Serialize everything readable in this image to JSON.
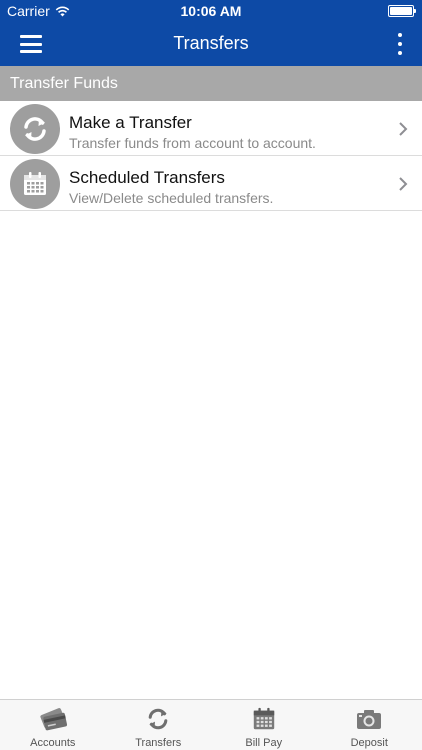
{
  "status": {
    "carrier": "Carrier",
    "time": "10:06 AM"
  },
  "nav": {
    "title": "Transfers"
  },
  "section": {
    "title": "Transfer Funds"
  },
  "items": [
    {
      "title": "Make a Transfer",
      "subtitle": "Transfer funds from account to account.",
      "icon": "transfer-arrows-icon"
    },
    {
      "title": "Scheduled Transfers",
      "subtitle": "View/Delete scheduled transfers.",
      "icon": "calendar-icon"
    }
  ],
  "tabs": [
    {
      "label": "Accounts",
      "icon": "accounts-cards-icon"
    },
    {
      "label": "Transfers",
      "icon": "transfer-arrows-icon"
    },
    {
      "label": "Bill Pay",
      "icon": "calendar-icon"
    },
    {
      "label": "Deposit",
      "icon": "camera-icon"
    }
  ],
  "colors": {
    "brand": "#0d4aa6",
    "section": "#a8a8a8",
    "icon_gray": "#9e9e9e",
    "chevron": "#8e8e93"
  }
}
